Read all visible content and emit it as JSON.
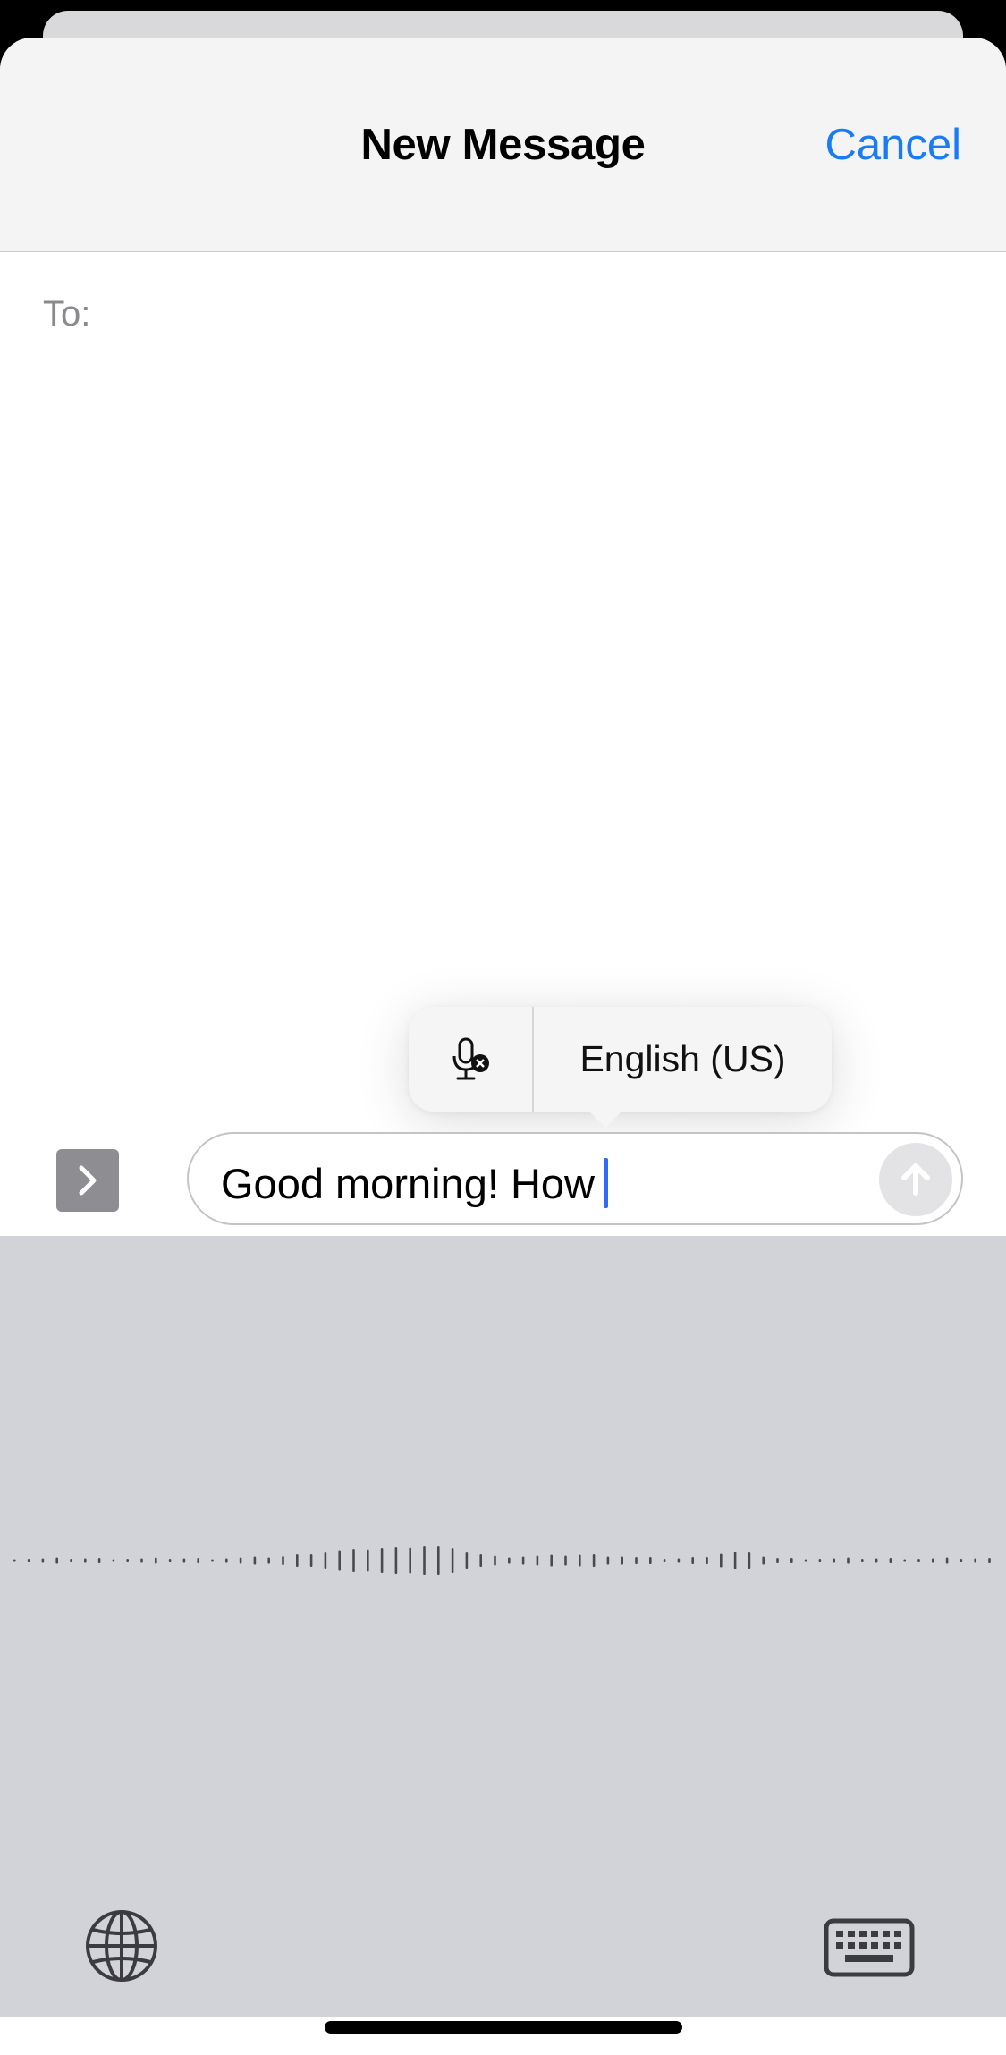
{
  "header": {
    "title": "New Message",
    "cancel_label": "Cancel"
  },
  "recipient": {
    "label": "To:",
    "value": ""
  },
  "dictation": {
    "icon": "mic-slash-icon",
    "language": "English (US)"
  },
  "composer": {
    "text": "Good morning! How",
    "send_icon": "arrow-up-icon",
    "expand_icon": "chevron-right-icon"
  },
  "keyboard": {
    "globe_icon": "globe-icon",
    "keyboard_icon": "keyboard-icon"
  },
  "colors": {
    "accent": "#1a7cf2",
    "cursor": "#2f6bf5",
    "keyboard_bg": "#d2d3d8",
    "nav_bg": "#f4f4f5"
  }
}
